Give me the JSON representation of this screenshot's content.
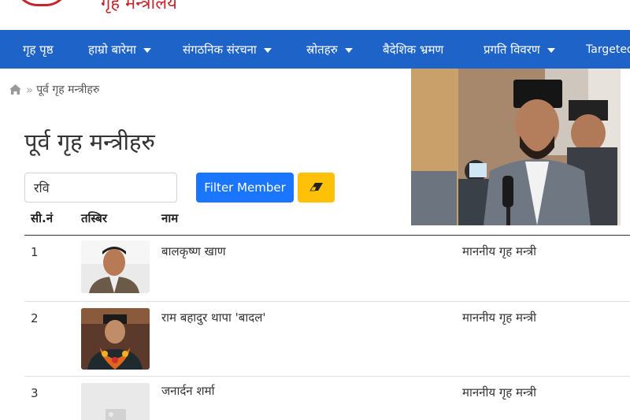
{
  "header": {
    "site_title": "गृह मन्त्रालय"
  },
  "nav": {
    "items": [
      {
        "label": "गृह पृष्ठ",
        "has_dropdown": false
      },
      {
        "label": "हाम्रो बारेमा",
        "has_dropdown": true
      },
      {
        "label": "संगठनिक संरचना",
        "has_dropdown": true
      },
      {
        "label": "स्रोतहरु",
        "has_dropdown": true
      },
      {
        "label": "बैदेशिक भ्रमण",
        "has_dropdown": false
      },
      {
        "label": "प्रगति विवरण",
        "has_dropdown": true
      },
      {
        "label": "Targeted",
        "has_dropdown": false
      }
    ]
  },
  "breadcrumb": {
    "current": "पूर्व गृह मन्त्रीहरु",
    "separator": "»"
  },
  "page": {
    "title": "पूर्व गृह मन्त्रीहरु"
  },
  "filter": {
    "search_value": "रवि",
    "filter_button_label": "Filter Member",
    "clear_icon": "eraser-icon"
  },
  "table": {
    "headers": [
      "सी.नं",
      "तस्बिर",
      "नाम"
    ],
    "rows": [
      {
        "sn": "1",
        "name": "बालकृष्ण खाण",
        "position": "माननीय गृह मन्त्री",
        "photo": "portrait"
      },
      {
        "sn": "2",
        "name": "राम बहादुर थापा 'बादल'",
        "position": "माननीय गृह मन्त्री",
        "photo": "portrait"
      },
      {
        "sn": "3",
        "name": "जनार्दन शर्मा",
        "position": "माननीय गृह मन्त्री",
        "photo": "placeholder"
      }
    ]
  },
  "colors": {
    "nav_bg": "#1e64c8",
    "filter_button": "#1a75ff",
    "clear_button": "#ffc107",
    "brand_red": "#c0282d"
  }
}
